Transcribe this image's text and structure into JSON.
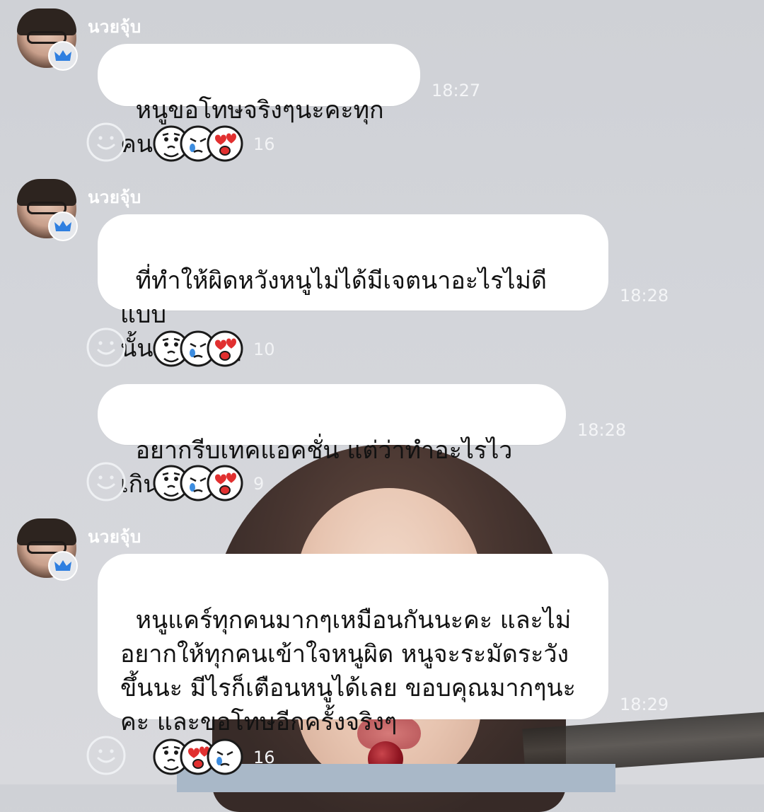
{
  "theme": {
    "bubble_color": "#ffffff",
    "text_color": "#121212",
    "meta_color": "#f4f5f7",
    "accent_blue": "#2f7fe0"
  },
  "messages": [
    {
      "sender": "นวยจุ้บ",
      "text": "หนูขอโทษจริงๆนะคะทุกคน",
      "time": "18:27",
      "reactions": {
        "icons": [
          "worried-face-icon",
          "crying-face-icon",
          "heart-eyes-face-icon"
        ],
        "count": "16"
      }
    },
    {
      "sender": "นวยจุ้บ",
      "text": "ที่ทำให้ผิดหวังหนูไม่ได้มีเจตนาอะไรไม่ดีแบบ\nนั้นเลยจริงๆ",
      "time": "18:28",
      "reactions": {
        "icons": [
          "worried-face-icon",
          "crying-face-icon",
          "heart-eyes-face-icon"
        ],
        "count": "10"
      }
    },
    {
      "sender": "",
      "text": "อยากรีบเทคแอคชั่น แต่ว่าทำอะไรไวเกิน",
      "time": "18:28",
      "reactions": {
        "icons": [
          "worried-face-icon",
          "crying-face-icon",
          "heart-eyes-face-icon"
        ],
        "count": "9"
      }
    },
    {
      "sender": "นวยจุ้บ",
      "text": "หนูแคร์ทุกคนมากๆเหมือนกันนะคะ และไม่\nอยากให้ทุกคนเข้าใจหนูผิด หนูจะระมัดระวัง\nขึ้นนะ มีไรก็เตือนหนูได้เลย ขอบคุณมากๆนะ\nคะ และขอโทษอีกครั้งจริงๆ",
      "time": "18:29",
      "reactions": {
        "icons": [
          "worried-face-icon",
          "heart-eyes-face-icon",
          "crying-face-icon"
        ],
        "count": "16"
      }
    }
  ]
}
